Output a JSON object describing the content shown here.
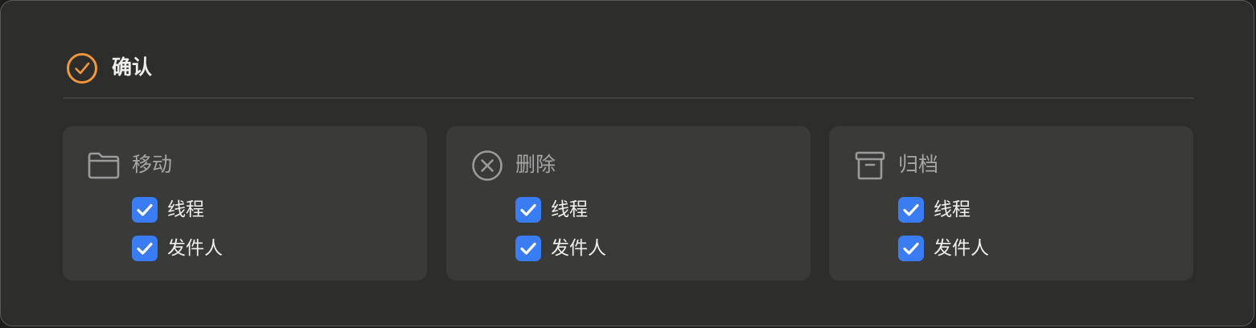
{
  "header": {
    "title": "确认",
    "icon": "check-circle-icon",
    "accent_color": "#f0963c"
  },
  "cards": [
    {
      "title": "移动",
      "icon": "folder-icon",
      "options": [
        {
          "label": "线程",
          "checked": true
        },
        {
          "label": "发件人",
          "checked": true
        }
      ]
    },
    {
      "title": "删除",
      "icon": "x-circle-icon",
      "options": [
        {
          "label": "线程",
          "checked": true
        },
        {
          "label": "发件人",
          "checked": true
        }
      ]
    },
    {
      "title": "归档",
      "icon": "archive-box-icon",
      "options": [
        {
          "label": "线程",
          "checked": true
        },
        {
          "label": "发件人",
          "checked": true
        }
      ]
    }
  ],
  "colors": {
    "checkbox": "#3a7cf3",
    "card_bg": "#3a3a39",
    "window_bg": "#2d2d2b"
  }
}
